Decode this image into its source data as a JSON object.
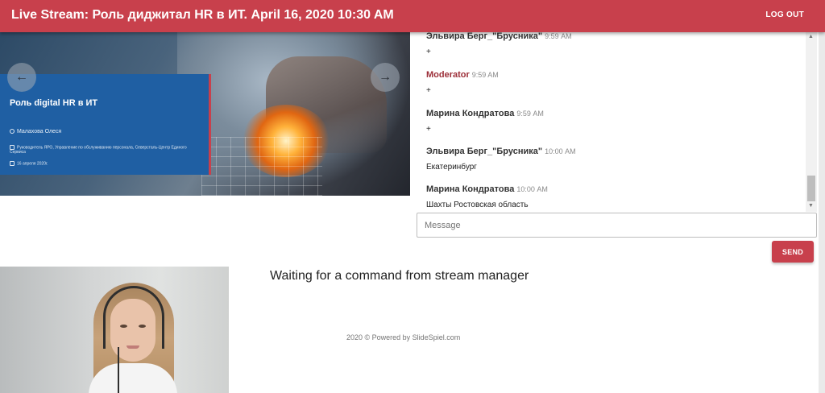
{
  "header": {
    "title": "Live Stream: Роль диджитал HR в ИТ. April 16, 2020 10:30 AM",
    "logout_label": "LOG OUT"
  },
  "slide": {
    "heading": "Роль digital HR в ИТ",
    "author": "Малахова Олеся",
    "role": "Руководитель ЯРО, Управление по обслуживанию персонала, Северсталь-Центр Единого Сервиса",
    "date": "16 апреля 2020г.",
    "prev_icon": "arrow-left-icon",
    "next_icon": "arrow-right-icon"
  },
  "chat": {
    "messages": [
      {
        "author": "Эльвира Берг_\"Брусника\"",
        "time": "9:59 AM",
        "text": "+",
        "moderator": false
      },
      {
        "author": "Moderator",
        "time": "9:59 AM",
        "text": "+",
        "moderator": true
      },
      {
        "author": "Марина Кондратова",
        "time": "9:59 AM",
        "text": "+",
        "moderator": false
      },
      {
        "author": "Эльвира Берг_\"Брусника\"",
        "time": "10:00 AM",
        "text": "Екатеринбург",
        "moderator": false
      },
      {
        "author": "Марина Кондратова",
        "time": "10:00 AM",
        "text": "Шахты Ростовская область",
        "moderator": false
      }
    ],
    "input_placeholder": "Message",
    "input_value": "",
    "send_label": "SEND"
  },
  "status_text": "Waiting for a command from stream manager",
  "footer_text": "2020 © Powered by SlideSpiel.com",
  "colors": {
    "brand": "#c8404c",
    "moderator": "#9c2e38",
    "slide_panel": "#1f5fa3"
  }
}
